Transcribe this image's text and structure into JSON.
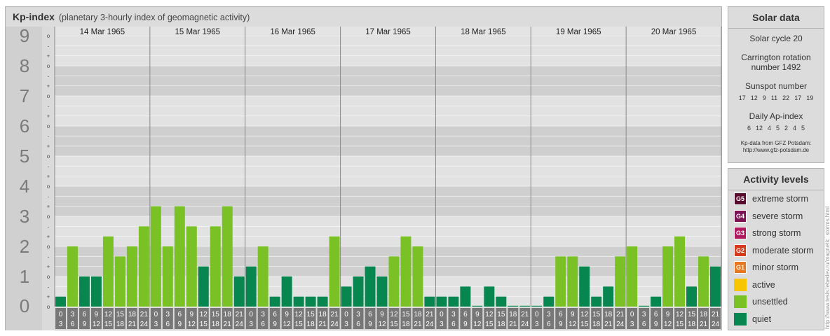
{
  "header": {
    "title": "Kp-index",
    "subtitle": "(planetary 3-hourly index of geomagnetic activity)"
  },
  "chart_data": {
    "type": "bar",
    "title": "Kp-index",
    "subtitle": "(planetary 3-hourly index of geomagnetic activity)",
    "ylim": [
      0,
      9
    ],
    "y_ticks": [
      "0",
      "1",
      "2",
      "3",
      "4",
      "5",
      "6",
      "7",
      "8",
      "9"
    ],
    "sub_ticks": [
      "o",
      "+",
      "-"
    ],
    "days": [
      "14 Mar 1965",
      "15 Mar 1965",
      "16 Mar 1965",
      "17 Mar 1965",
      "18 Mar 1965",
      "19 Mar 1965",
      "20 Mar 1965"
    ],
    "hour_labels": [
      [
        "0",
        "3"
      ],
      [
        "3",
        "6"
      ],
      [
        "6",
        "9"
      ],
      [
        "9",
        "12"
      ],
      [
        "12",
        "15"
      ],
      [
        "15",
        "18"
      ],
      [
        "18",
        "21"
      ],
      [
        "21",
        "24"
      ]
    ],
    "values": [
      0.333,
      2.0,
      1.0,
      1.0,
      2.333,
      1.667,
      2.0,
      2.667,
      3.333,
      2.0,
      3.333,
      2.667,
      1.333,
      2.667,
      3.333,
      1.0,
      1.333,
      2.0,
      0.333,
      1.0,
      0.333,
      0.333,
      0.333,
      2.333,
      0.667,
      1.0,
      1.333,
      1.0,
      1.667,
      2.333,
      2.0,
      0.333,
      0.333,
      0.333,
      0.667,
      0.0,
      0.667,
      0.333,
      0.0,
      0.0,
      0.0,
      0.333,
      1.667,
      1.667,
      1.333,
      0.333,
      0.667,
      1.667,
      2.0,
      0.0,
      0.333,
      2.0,
      2.333,
      0.667,
      1.667,
      1.333
    ],
    "grid": true
  },
  "solar": {
    "title": "Solar data",
    "cycle": "Solar cycle 20",
    "carrington_line1": "Carrington rotation",
    "carrington_line2": "number 1492",
    "sunspot_title": "Sunspot number",
    "sunspot_values": [
      "17",
      "12",
      "9",
      "11",
      "22",
      "17",
      "19"
    ],
    "ap_title": "Daily Ap-index",
    "ap_values": [
      "6",
      "12",
      "4",
      "5",
      "2",
      "4",
      "5"
    ],
    "credit_line1": "Kp-data from GFZ Potsdam:",
    "credit_line2": "http://www.gfz-potsdam.de"
  },
  "levels": {
    "title": "Activity levels",
    "items": [
      {
        "badge": "G5",
        "label": "extreme storm",
        "color": "#5a0a2d"
      },
      {
        "badge": "G4",
        "label": "severe storm",
        "color": "#7d1154"
      },
      {
        "badge": "G3",
        "label": "strong storm",
        "color": "#b0185d"
      },
      {
        "badge": "G2",
        "label": "moderate storm",
        "color": "#d43a1c"
      },
      {
        "badge": "G1",
        "label": "minor storm",
        "color": "#e8771d"
      },
      {
        "badge": "",
        "label": "active",
        "color": "#f7c600"
      },
      {
        "badge": "",
        "label": "unsettled",
        "color": "#7ac126"
      },
      {
        "badge": "",
        "label": "quiet",
        "color": "#07874f"
      }
    ]
  },
  "colors": {
    "unsettled": "#7ac126",
    "quiet": "#07874f",
    "axis_number": "#7a7a7a",
    "hour_box": "#777777"
  },
  "watermark": "http://www.tesis.lebedev.ru/magnetic_storms.html"
}
